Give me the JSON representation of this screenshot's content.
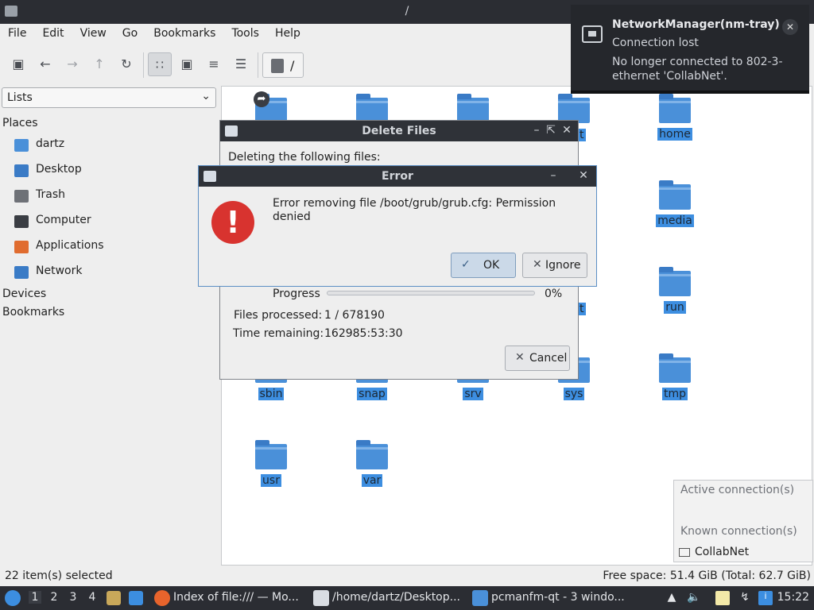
{
  "window": {
    "title": "/"
  },
  "menu": [
    "File",
    "Edit",
    "View",
    "Go",
    "Bookmarks",
    "Tools",
    "Help"
  ],
  "toolbar": {
    "path": "/",
    "icons": [
      "new-tab-icon",
      "back-icon",
      "forward-icon",
      "up-icon",
      "reload-icon",
      "icon-view-icon",
      "thumbnail-view-icon",
      "compact-view-icon",
      "detailed-list-icon",
      "computer-icon"
    ]
  },
  "sidepane": {
    "combo": "Lists",
    "places_header": "Places",
    "places": [
      {
        "label": "dartz",
        "icon": "home-folder-icon",
        "color": "#4a90d9"
      },
      {
        "label": "Desktop",
        "icon": "desktop-icon",
        "color": "#3a7bc6"
      },
      {
        "label": "Trash",
        "icon": "trash-icon",
        "color": "#6e7177"
      },
      {
        "label": "Computer",
        "icon": "computer-icon",
        "color": "#3a3d43"
      },
      {
        "label": "Applications",
        "icon": "applications-icon",
        "color": "#e06c2f"
      },
      {
        "label": "Network",
        "icon": "network-icon",
        "color": "#3a7bc6"
      }
    ],
    "devices_header": "Devices",
    "bookmarks_header": "Bookmarks"
  },
  "folders": [
    "home",
    "media",
    "run",
    "sbin",
    "snap",
    "srv",
    "sys",
    "tmp",
    "usr",
    "var",
    "t",
    "t"
  ],
  "delete_dialog": {
    "title": "Delete Files",
    "heading": "Deleting the following files:",
    "progress_label": "Progress",
    "progress_value": "0%",
    "progress_fraction": 0,
    "files_processed_label": "Files processed:",
    "files_processed_value": "1 / 678190",
    "time_remaining_label": "Time remaining:",
    "time_remaining_value": "162985:53:30",
    "cancel_label": "Cancel"
  },
  "error_dialog": {
    "title": "Error",
    "message": "Error removing file /boot/grub/grub.cfg: Permission denied",
    "ok_label": "OK",
    "ignore_label": "Ignore"
  },
  "notification": {
    "title": "NetworkManager(nm-tray)",
    "subtitle": "Connection lost",
    "body": "No longer connected to 802-3-ethernet 'CollabNet'."
  },
  "connection_popup": {
    "active_header": "Active connection(s)",
    "known_header": "Known connection(s)",
    "item": "CollabNet"
  },
  "statusbar": {
    "left": "22 item(s) selected",
    "right": "Free space: 51.4 GiB (Total: 62.7 GiB)"
  },
  "taskbar": {
    "workspaces": [
      "1",
      "2",
      "3",
      "4"
    ],
    "tasks": [
      {
        "label": "Index of file:/// — Mo...",
        "color": "#e8642c"
      },
      {
        "label": "/home/dartz/Desktop...",
        "color": "#d9dde3"
      },
      {
        "label": "pcmanfm-qt - 3 windo...",
        "color": "#4a90d9"
      }
    ],
    "clock": "15:22"
  }
}
